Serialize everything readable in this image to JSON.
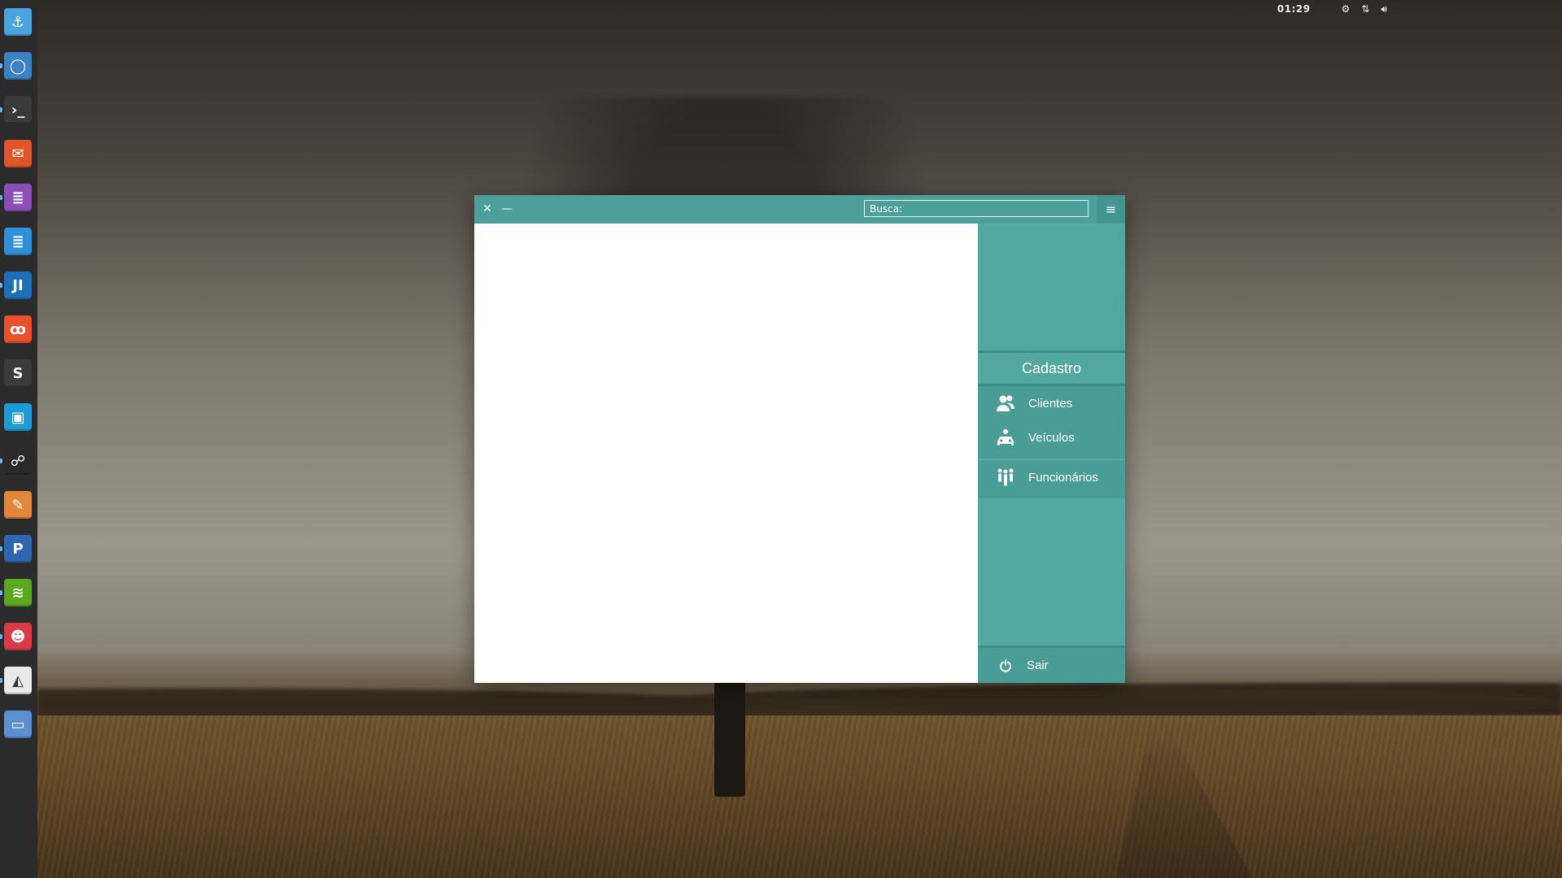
{
  "topbar": {
    "clock": "01:29",
    "icons": [
      "gear-icon",
      "network-icon",
      "volume-icon"
    ]
  },
  "dock": {
    "apps": [
      {
        "name": "anchor-icon",
        "color": "#4aa3df",
        "glyph": "⚓"
      },
      {
        "name": "chromium-icon",
        "color": "#3b82c4",
        "glyph": "◯"
      },
      {
        "name": "terminal-icon",
        "color": "#3a3a3a",
        "glyph": "›_"
      },
      {
        "name": "mail-icon",
        "color": "#e0562b",
        "glyph": "✉"
      },
      {
        "name": "text-editor-icon",
        "color": "#8c4fb8",
        "glyph": "≣"
      },
      {
        "name": "document-icon",
        "color": "#2f90d8",
        "glyph": "≣"
      },
      {
        "name": "intellij-icon",
        "color": "#1d6fb8",
        "glyph": "JI"
      },
      {
        "name": "xampp-icon",
        "color": "#e8512a",
        "glyph": "ꝏ"
      },
      {
        "name": "sublime-icon",
        "color": "#3b3b3b",
        "glyph": "S"
      },
      {
        "name": "monitor-icon",
        "color": "#1e9ad6",
        "glyph": "▣"
      },
      {
        "name": "steam-icon",
        "color": "#2a2a2a",
        "glyph": "☍"
      },
      {
        "name": "gimp-icon",
        "color": "#e2863a",
        "glyph": "✎"
      },
      {
        "name": "pencil-p-icon",
        "color": "#2f66b0",
        "glyph": "P"
      },
      {
        "name": "spotify-icon",
        "color": "#5aa81f",
        "glyph": "≋"
      },
      {
        "name": "game-icon",
        "color": "#d93a45",
        "glyph": "☻"
      },
      {
        "name": "inkscape-icon",
        "color": "#e9e9e9",
        "glyph": "◭"
      },
      {
        "name": "window-icon",
        "color": "#5a8fd0",
        "glyph": "▭"
      }
    ]
  },
  "window": {
    "close_glyph": "✕",
    "minimize_glyph": "—",
    "search_value": "Busca:",
    "menu_glyph": "≡"
  },
  "sidebar": {
    "section_title": "Cadastro",
    "items": [
      {
        "label": "Clientes",
        "icon": "users-icon"
      },
      {
        "label": "Veículos",
        "icon": "car-icon"
      },
      {
        "label": "Funcionários",
        "icon": "employees-icon"
      }
    ],
    "exit_label": "Sair",
    "exit_icon": "power-icon"
  },
  "colors": {
    "titlebar": "#4c9f9a",
    "sidebar": "#52a7a0",
    "sidebar_menu": "#4a9c96",
    "separator": "#3f8d88"
  }
}
